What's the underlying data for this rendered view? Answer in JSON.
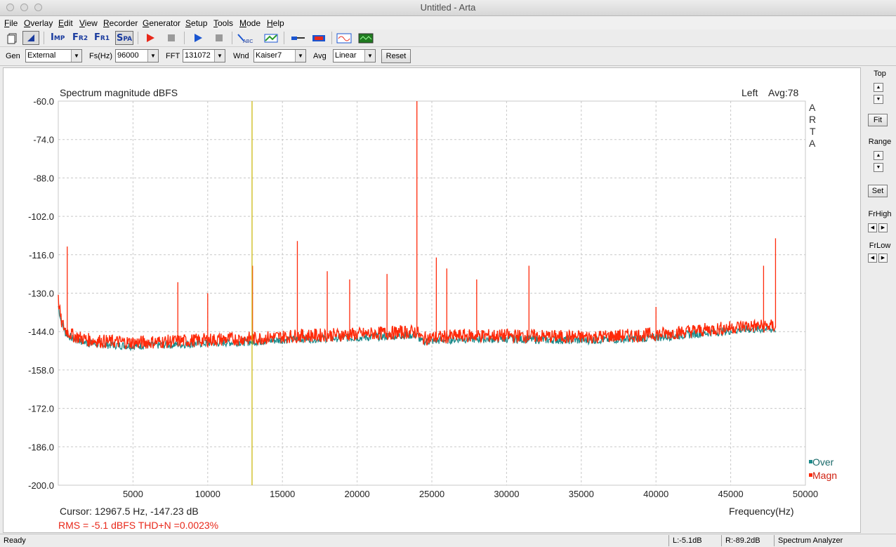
{
  "window": {
    "title": "Untitled - Arta"
  },
  "menu": [
    {
      "pre": "",
      "u": "F",
      "post": "ile"
    },
    {
      "pre": "",
      "u": "O",
      "post": "verlay"
    },
    {
      "pre": "",
      "u": "E",
      "post": "dit"
    },
    {
      "pre": "",
      "u": "V",
      "post": "iew"
    },
    {
      "pre": "",
      "u": "R",
      "post": "ecorder"
    },
    {
      "pre": "",
      "u": "G",
      "post": "enerator"
    },
    {
      "pre": "",
      "u": "S",
      "post": "etup"
    },
    {
      "pre": "",
      "u": "T",
      "post": "ools"
    },
    {
      "pre": "",
      "u": "M",
      "post": "ode"
    },
    {
      "pre": "",
      "u": "H",
      "post": "elp"
    }
  ],
  "toolbar": {
    "imp": {
      "big": "I",
      "small": "MP"
    },
    "fr2": {
      "big": "F",
      "small": "R2"
    },
    "fr1": {
      "big": "F",
      "small": "R1"
    },
    "spa": {
      "big": "S",
      "small": "PA"
    },
    "abc_label": "ABC"
  },
  "params": {
    "gen_label": "Gen",
    "gen_value": "External",
    "fs_label": "Fs(Hz)",
    "fs_value": "96000",
    "fft_label": "FFT",
    "fft_value": "131072",
    "wnd_label": "Wnd",
    "wnd_value": "Kaiser7",
    "avg_label": "Avg",
    "avg_value": "Linear",
    "reset_label": "Reset"
  },
  "right_panel": {
    "top_label": "Top",
    "fit_label": "Fit",
    "range_label": "Range",
    "set_label": "Set",
    "frhigh_label": "FrHigh",
    "frlow_label": "FrLow"
  },
  "plot": {
    "title": "Spectrum magnitude dBFS",
    "channel": "Left",
    "avg_text": "Avg:78",
    "arta_letters": [
      "A",
      "R",
      "T",
      "A"
    ],
    "xlabel": "Frequency(Hz)",
    "cursor_text": "Cursor: 12967.5 Hz, -147.23 dB",
    "rms_text": "RMS =    -5.1 dBFS   THD+N =0.0023%",
    "cursor_freq": 12967.5,
    "cursor_color": "#c8b400",
    "rms_color": "#e8281a"
  },
  "chart_data": {
    "type": "line",
    "title": "Spectrum magnitude dBFS",
    "xlabel": "Frequency(Hz)",
    "ylabel": "",
    "xlim": [
      0,
      50000
    ],
    "ylim": [
      -200,
      -60
    ],
    "x_ticks": [
      5000,
      10000,
      15000,
      20000,
      25000,
      30000,
      35000,
      40000,
      45000,
      50000
    ],
    "y_ticks": [
      -60.0,
      -74.0,
      -88.0,
      -102.0,
      -116.0,
      -130.0,
      -144.0,
      -158.0,
      -172.0,
      -186.0,
      -200.0
    ],
    "grid": true,
    "legend_position": "bottom-right",
    "series": [
      {
        "name": "Over",
        "color": "#1a8a8a",
        "x": [
          0,
          200,
          500,
          1000,
          2000,
          3000,
          5000,
          8000,
          10000,
          13000,
          16000,
          20000,
          24000,
          24300,
          27000,
          30000,
          35000,
          38000,
          40000,
          43000,
          46000,
          48000
        ],
        "y": [
          -135,
          -141,
          -145,
          -147,
          -148.5,
          -149,
          -149.5,
          -149,
          -148.5,
          -148,
          -147,
          -146.5,
          -145.5,
          -148,
          -147,
          -147,
          -147.5,
          -147,
          -146.5,
          -145,
          -143.5,
          -143.5
        ]
      },
      {
        "name": "Magn",
        "color": "#ff2a0a",
        "x": [
          0,
          200,
          500,
          1000,
          2000,
          3000,
          5000,
          8000,
          10000,
          13000,
          16000,
          20000,
          24000,
          24300,
          27000,
          30000,
          35000,
          38000,
          40000,
          43000,
          46000,
          48000
        ],
        "y": [
          -133,
          -141,
          -144,
          -146,
          -147.5,
          -148,
          -148.5,
          -148,
          -147.5,
          -147,
          -146,
          -145.5,
          -144.5,
          -147,
          -146,
          -146,
          -146.5,
          -146,
          -145.5,
          -144,
          -142.5,
          -142.5
        ]
      }
    ],
    "peaks": [
      {
        "x": 24000,
        "y": -60
      },
      {
        "x": 48000,
        "y": -110
      },
      {
        "x": 600,
        "y": -113
      },
      {
        "x": 16000,
        "y": -111
      },
      {
        "x": 18000,
        "y": -122
      },
      {
        "x": 19500,
        "y": -125
      },
      {
        "x": 22000,
        "y": -123
      },
      {
        "x": 25300,
        "y": -117
      },
      {
        "x": 26000,
        "y": -121
      },
      {
        "x": 28000,
        "y": -125
      },
      {
        "x": 31500,
        "y": -120
      },
      {
        "x": 8000,
        "y": -126
      },
      {
        "x": 10000,
        "y": -130
      },
      {
        "x": 13000,
        "y": -120
      },
      {
        "x": 47200,
        "y": -120
      },
      {
        "x": 40000,
        "y": -135
      }
    ]
  }
}
